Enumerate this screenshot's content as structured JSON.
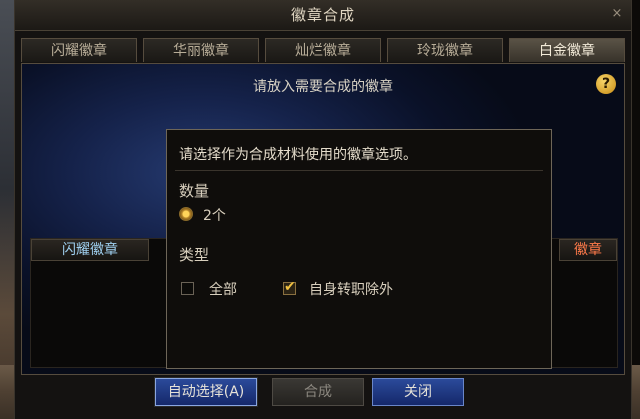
{
  "window": {
    "title": "徽章合成",
    "close_glyph": "×"
  },
  "tabs": [
    {
      "label": "闪耀徽章",
      "active": false
    },
    {
      "label": "华丽徽章",
      "active": false
    },
    {
      "label": "灿烂徽章",
      "active": false
    },
    {
      "label": "玲珑徽章",
      "active": false
    },
    {
      "label": "白金徽章",
      "active": true
    }
  ],
  "panel": {
    "hint": "请放入需要合成的徽章",
    "help_label": "?",
    "list_header_left": "闪耀徽章",
    "list_header_right": "徽章"
  },
  "buttons": {
    "auto_select": "自动选择(A)",
    "synthesize": "合成",
    "close": "关闭"
  },
  "popup": {
    "title": "请选择作为合成材料使用的徽章选项。",
    "quantity_label": "数量",
    "quantity_option": "2个",
    "quantity_selected": true,
    "type_label": "类型",
    "type_options": [
      {
        "label": "全部",
        "checked": false
      },
      {
        "label": "自身转职除外",
        "checked": true
      }
    ]
  },
  "colors": {
    "accent_blue": "#2b4a9a",
    "radio_gold": "#ffd45a",
    "right_header_orange": "#ff7a4a",
    "left_header_blue": "#9fd0f0"
  }
}
